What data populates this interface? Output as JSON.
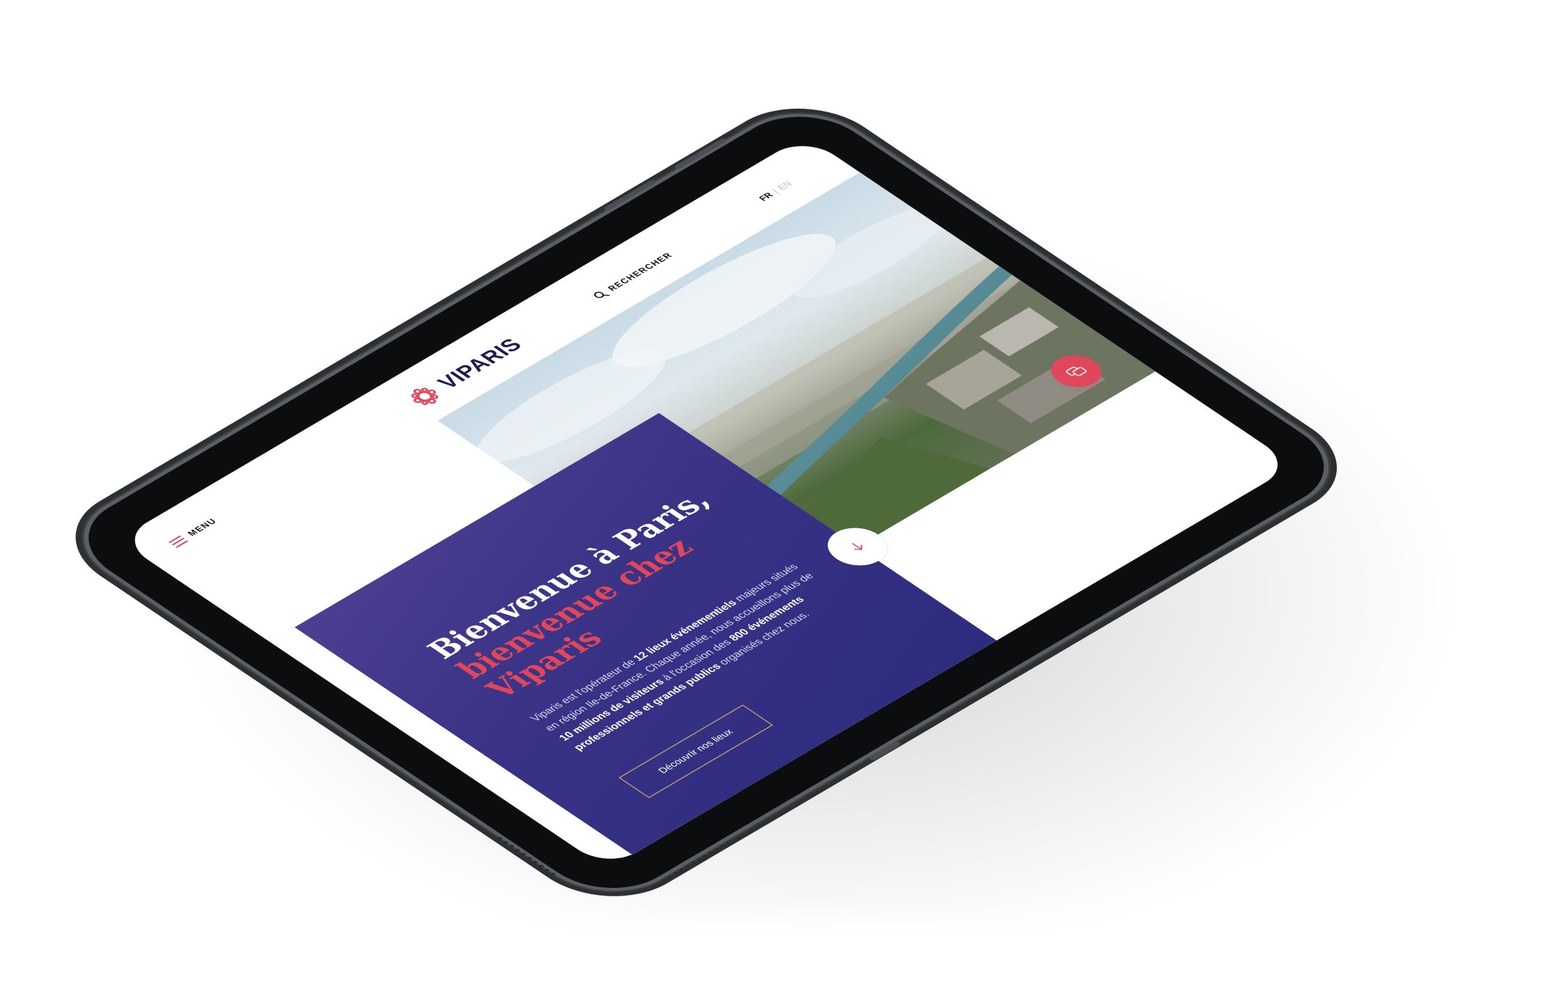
{
  "header": {
    "menu_label": "MENU",
    "logo_text": "VIPARIS",
    "search_label": "RECHERCHER",
    "lang_active": "FR",
    "lang_other": "EN"
  },
  "hero": {
    "title_line1": "Bienvenue à Paris,",
    "title_line2": "bienvenue chez",
    "title_line3": "Viparis",
    "text_part1": "Viparis est l'opérateur de ",
    "text_bold1": "12 lieux événementiels",
    "text_part2": " majeurs situés en région Ile-de-France. Chaque année, nous accueillons plus de ",
    "text_bold2": "10 millions de visiteurs",
    "text_part3": " à l'occasion des ",
    "text_bold3": "800 événements professionnels et grands publics",
    "text_part4": " organisés chez nous.",
    "cta_label": "Découvrir nos lieux"
  },
  "colors": {
    "brand_navy": "#2c2c7e",
    "accent_red": "#e0475a",
    "cta_border": "#c6a867"
  },
  "icons": {
    "menu": "hamburger-icon",
    "search": "search-icon",
    "scroll": "arrow-down-icon",
    "chat": "chat-icon",
    "logo": "viparis-logo-icon"
  }
}
